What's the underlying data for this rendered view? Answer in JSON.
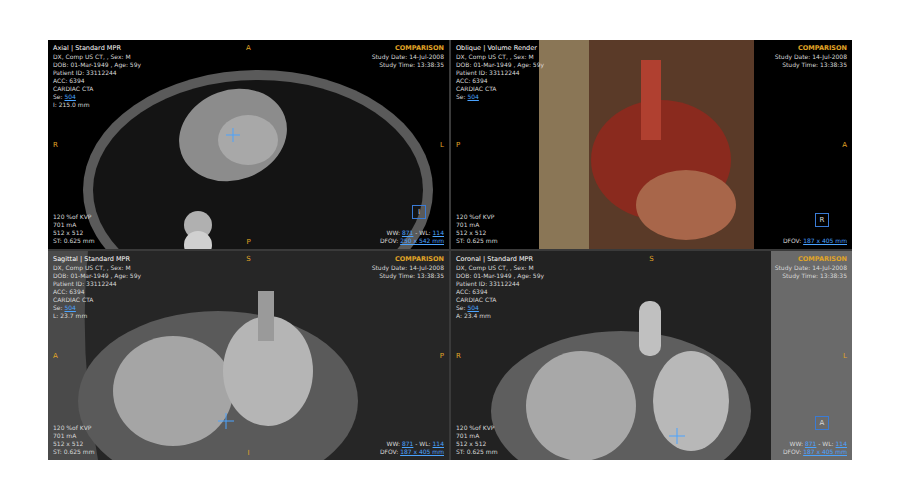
{
  "viewports": [
    {
      "kind": "axial",
      "title": "Axial | Standard MPR",
      "top_left": [
        [
          {
            "text": "DX, Comp US CT, , Sex: M",
            "link": false
          }
        ],
        [
          {
            "text": "DOB: 01-Mar-1949 , Age: 59y",
            "link": false
          }
        ],
        [
          {
            "text": "Patient ID: 33112244",
            "link": false
          }
        ],
        [
          {
            "text": "ACC: 6394",
            "link": false
          }
        ],
        [
          {
            "text": "CARDIAC CTA",
            "link": false
          }
        ],
        [
          {
            "text": "Se: ",
            "link": false
          },
          {
            "text": "504",
            "link": true
          }
        ],
        [
          {
            "text": "I: 215.0 mm",
            "link": false
          }
        ]
      ],
      "top_right": {
        "label": "COMPARISON",
        "lines": [
          "Study Date: 14-Jul-2008",
          "Study Time: 13:38:35"
        ]
      },
      "bottom_left": [
        "120 %of KVP",
        "701 mA",
        "512 x 512",
        "ST: 0.625 mm"
      ],
      "bottom_right": [
        [
          {
            "text": "WW: ",
            "link": false
          },
          {
            "text": "871",
            "link": true
          },
          {
            "text": " - WL: ",
            "link": false
          },
          {
            "text": "114",
            "link": true
          }
        ],
        [
          {
            "text": "DFOV: ",
            "link": false
          },
          {
            "text": "250 x 542 mm",
            "link": true
          }
        ]
      ],
      "orientation": {
        "top": "A",
        "left": "R",
        "right": "L",
        "bottom": "P"
      },
      "box": "I"
    },
    {
      "kind": "volume",
      "title": "Oblique | Volume Render",
      "top_left": [
        [
          {
            "text": "DX, Comp US CT, , Sex: M",
            "link": false
          }
        ],
        [
          {
            "text": "DOB: 01-Mar-1949 , Age: 59y",
            "link": false
          }
        ],
        [
          {
            "text": "Patient ID: 33112244",
            "link": false
          }
        ],
        [
          {
            "text": "ACC: 6394",
            "link": false
          }
        ],
        [
          {
            "text": "CARDIAC CTA",
            "link": false
          }
        ],
        [
          {
            "text": "Se: ",
            "link": false
          },
          {
            "text": "504",
            "link": true
          }
        ]
      ],
      "top_right": {
        "label": "COMPARISON",
        "lines": [
          "Study Date: 14-Jul-2008",
          "Study Time: 13:38:35"
        ]
      },
      "bottom_left": [
        "120 %of KVP",
        "701 mA",
        "512 x 512",
        "ST: 0.625 mm"
      ],
      "bottom_right": [
        [
          {
            "text": "DFOV: ",
            "link": false
          },
          {
            "text": "187 x 405 mm",
            "link": true
          }
        ]
      ],
      "orientation": {
        "left": "P",
        "right": "A"
      },
      "box": "R"
    },
    {
      "kind": "sagittal",
      "title": "Sagittal | Standard MPR",
      "top_left": [
        [
          {
            "text": "DX, Comp US CT, , Sex: M",
            "link": false
          }
        ],
        [
          {
            "text": "DOB: 01-Mar-1949 , Age: 59y",
            "link": false
          }
        ],
        [
          {
            "text": "Patient ID: 33112244",
            "link": false
          }
        ],
        [
          {
            "text": "ACC: 6394",
            "link": false
          }
        ],
        [
          {
            "text": "CARDIAC CTA",
            "link": false
          }
        ],
        [
          {
            "text": "Se: ",
            "link": false
          },
          {
            "text": "504",
            "link": true
          }
        ],
        [
          {
            "text": "L: 23.7 mm",
            "link": false
          }
        ]
      ],
      "top_right": {
        "label": "COMPARISON",
        "lines": [
          "Study Date: 14-Jul-2008",
          "Study Time: 13:38:35"
        ]
      },
      "bottom_left": [
        "120 %of KVP",
        "701 mA",
        "512 x 512",
        "ST: 0.625 mm"
      ],
      "bottom_right": [
        [
          {
            "text": "WW: ",
            "link": false
          },
          {
            "text": "871",
            "link": true
          },
          {
            "text": " - WL: ",
            "link": false
          },
          {
            "text": "114",
            "link": true
          }
        ],
        [
          {
            "text": "DFOV: ",
            "link": false
          },
          {
            "text": "187 x 405 mm",
            "link": true
          }
        ]
      ],
      "orientation": {
        "top": "S",
        "left": "A",
        "right": "P",
        "bottom": "I"
      },
      "box": ""
    },
    {
      "kind": "coronal",
      "title": "Coronal | Standard MPR",
      "top_left": [
        [
          {
            "text": "DX, Comp US CT, , Sex: M",
            "link": false
          }
        ],
        [
          {
            "text": "DOB: 01-Mar-1949 , Age: 59y",
            "link": false
          }
        ],
        [
          {
            "text": "Patient ID: 33112244",
            "link": false
          }
        ],
        [
          {
            "text": "ACC: 6394",
            "link": false
          }
        ],
        [
          {
            "text": "CARDIAC CTA",
            "link": false
          }
        ],
        [
          {
            "text": "Se: ",
            "link": false
          },
          {
            "text": "504",
            "link": true
          }
        ],
        [
          {
            "text": "A: 23.4 mm",
            "link": false
          }
        ]
      ],
      "top_right": {
        "label": "COMPARISON",
        "lines": [
          "Study Date: 14-Jul-2008",
          "Study Time: 13:38:35"
        ]
      },
      "bottom_left": [
        "120 %of KVP",
        "701 mA",
        "512 x 512",
        "ST: 0.625 mm"
      ],
      "bottom_right": [
        [
          {
            "text": "WW: ",
            "link": false
          },
          {
            "text": "871",
            "link": true
          },
          {
            "text": " - WL: ",
            "link": false
          },
          {
            "text": "114",
            "link": true
          }
        ],
        [
          {
            "text": "DFOV: ",
            "link": false
          },
          {
            "text": "187 x 405 mm",
            "link": true
          }
        ]
      ],
      "orientation": {
        "top": "S",
        "left": "R",
        "right": "L"
      },
      "box": "A"
    }
  ]
}
